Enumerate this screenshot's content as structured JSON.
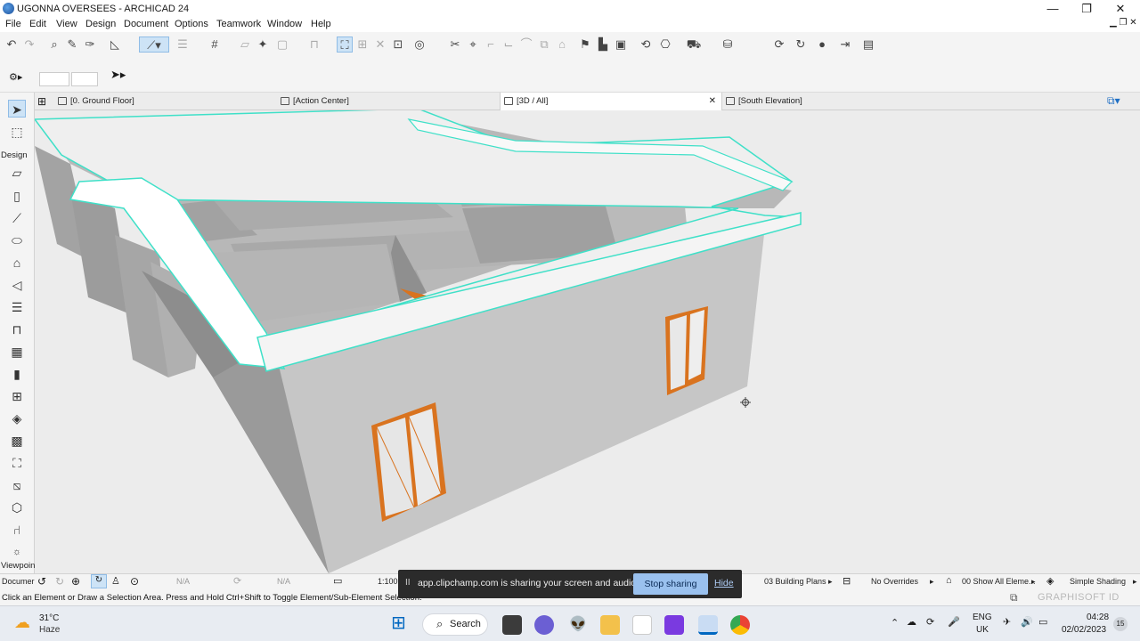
{
  "window": {
    "title": "UGONNA  OVERSEES - ARCHICAD 24",
    "minimize": "—",
    "maximize": "❐",
    "close": "✕"
  },
  "menu": [
    "File",
    "Edit",
    "View",
    "Design",
    "Document",
    "Options",
    "Teamwork",
    "Window",
    "Help"
  ],
  "toolbox": {
    "design_label": "Design",
    "viewpoint_label": "Viewpoin",
    "document_label": "Documer"
  },
  "tabs": [
    {
      "label": "[0. Ground Floor]"
    },
    {
      "label": "[Action Center]"
    },
    {
      "label": "[3D / All]",
      "close": "✕"
    },
    {
      "label": "[South Elevation]"
    }
  ],
  "viewbar": {
    "na1": "N/A",
    "na2": "N/A",
    "scale": "1:100",
    "layer_combo": "03 Building Plans",
    "overrides": "No Overrides",
    "renovation": "00 Show All Eleme...",
    "shading": "Simple Shading"
  },
  "status": {
    "hint": "Click an Element or Draw a Selection Area. Press and Hold Ctrl+Shift to Toggle Element/Sub-Element Selection.",
    "brand": "GRAPHISOFT ID"
  },
  "share_banner": {
    "pause": "II",
    "text": "app.clipchamp.com is sharing your screen and audio.",
    "stop": "Stop sharing",
    "hide": "Hide"
  },
  "taskbar": {
    "temperature": "31°C",
    "weather": "Haze",
    "search": "Search",
    "lang1": "ENG",
    "lang2": "UK",
    "time": "04:28",
    "date": "02/02/2023",
    "notifications": "15"
  },
  "colors": {
    "wall": "#c4c4c4",
    "frame": "#d9731f",
    "selection": "#3fe0c8",
    "accent": "#0067c0"
  }
}
